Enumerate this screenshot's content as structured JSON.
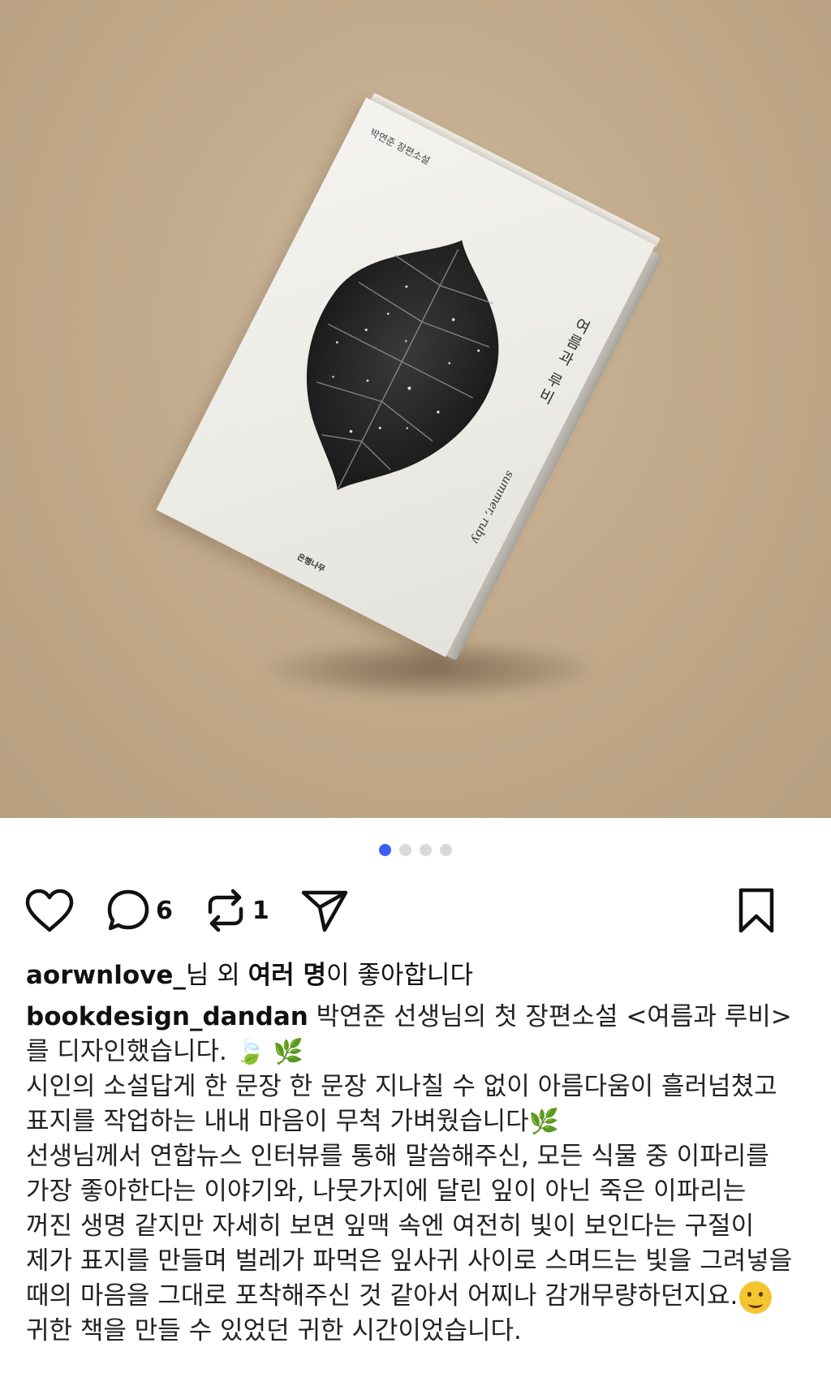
{
  "post": {
    "image": {
      "book": {
        "author_line": "박연준 장편소설",
        "title": "여름과 루비",
        "subtitle": "summer, ruby",
        "publisher": "은행나무"
      }
    },
    "carousel": {
      "total": 4,
      "active_index": 0
    }
  },
  "actions": {
    "like_icon": "heart-icon",
    "comment_icon": "comment-icon",
    "comment_count": "6",
    "repost_icon": "repost-icon",
    "repost_count": "1",
    "share_icon": "send-icon",
    "save_icon": "bookmark-icon"
  },
  "likes": {
    "user": "aorwnlove_",
    "mid": "님 외 ",
    "others": "여러 명",
    "suffix": "이 좋아합니다"
  },
  "caption": {
    "username": "bookdesign_dandan",
    "line1": " 박연준 선생님의 첫 장편소설 <여름과 루비>를 디자인했습니다.",
    "line1_emoji": "🍃 🌿",
    "line2": "시인의 소설답게 한 문장 한 문장 지나칠 수 없이 아름다움이 흘러넘쳤고 표지를 작업하는 내내 마음이 무척 가벼웠습니다",
    "line2_emoji": "🌿",
    "line3": "선생님께서 연합뉴스 인터뷰를 통해 말씀해주신, 모든 식물 중 이파리를 가장 좋아한다는 이야기와, 나뭇가지에 달린 잎이 아닌 죽은 이파리는 꺼진 생명 같지만 자세히 보면 잎맥 속엔 여전히 빛이 보인다는 구절이 제가 표지를 만들며 벌레가 파먹은 잎사귀 사이로 스며드는 빛을 그려넣을 때의 마음을 그대로 포착해주신 것 같아서 어찌나 감개무량하던지요.",
    "line3_emoji": "face-emoji",
    "line4": "귀한 책을 만들 수 있었던 귀한 시간이었습니다."
  }
}
